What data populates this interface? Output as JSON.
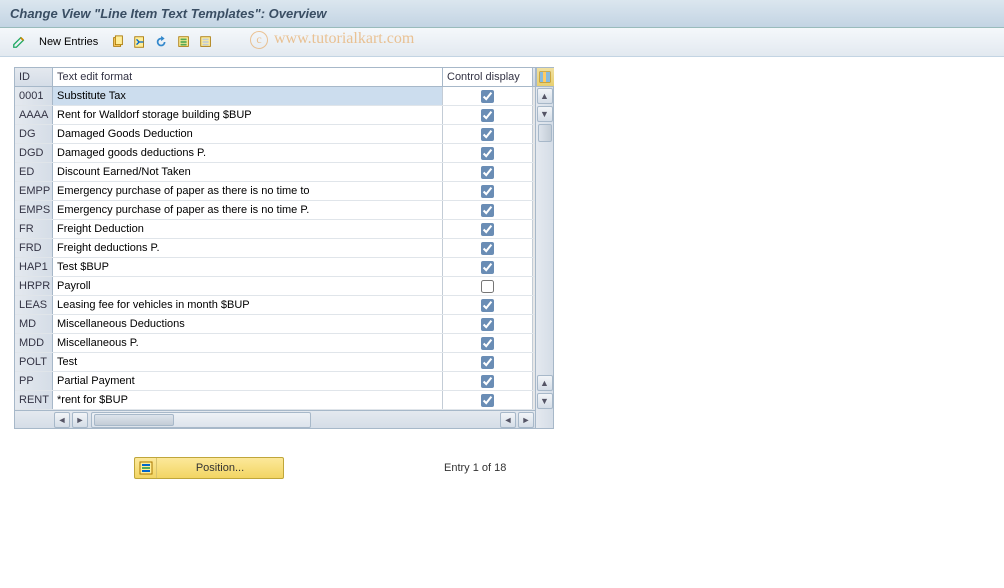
{
  "title": "Change View \"Line Item Text Templates\": Overview",
  "toolbar": {
    "new_entries_label": "New Entries"
  },
  "watermark": "www.tutorialkart.com",
  "table": {
    "headers": {
      "id": "ID",
      "text": "Text edit format",
      "ctrl": "Control display"
    },
    "rows": [
      {
        "id": "0001",
        "text": "Substitute Tax",
        "ctrl": true,
        "selected": true
      },
      {
        "id": "AAAA",
        "text": "Rent for Walldorf storage building $BUP",
        "ctrl": true
      },
      {
        "id": "DG",
        "text": "Damaged Goods Deduction",
        "ctrl": true
      },
      {
        "id": "DGD",
        "text": "Damaged goods deductions P.",
        "ctrl": true
      },
      {
        "id": "ED",
        "text": "Discount Earned/Not Taken",
        "ctrl": true
      },
      {
        "id": "EMPP",
        "text": "Emergency purchase of paper as there is no time to",
        "ctrl": true
      },
      {
        "id": "EMPS",
        "text": "Emergency purchase of paper as there is no time P.",
        "ctrl": true
      },
      {
        "id": "FR",
        "text": "Freight Deduction",
        "ctrl": true
      },
      {
        "id": "FRD",
        "text": "Freight deductions P.",
        "ctrl": true
      },
      {
        "id": "HAP1",
        "text": "Test $BUP",
        "ctrl": true
      },
      {
        "id": "HRPR",
        "text": "Payroll",
        "ctrl": false
      },
      {
        "id": "LEAS",
        "text": "Leasing fee for vehicles in month $BUP",
        "ctrl": true
      },
      {
        "id": "MD",
        "text": "Miscellaneous Deductions",
        "ctrl": true
      },
      {
        "id": "MDD",
        "text": "Miscellaneous P.",
        "ctrl": true
      },
      {
        "id": "POLT",
        "text": "Test",
        "ctrl": true
      },
      {
        "id": "PP",
        "text": "Partial Payment",
        "ctrl": true
      },
      {
        "id": "RENT",
        "text": "*rent for $BUP",
        "ctrl": true
      }
    ]
  },
  "footer": {
    "position_label": "Position...",
    "entry_text": "Entry 1 of 18"
  }
}
